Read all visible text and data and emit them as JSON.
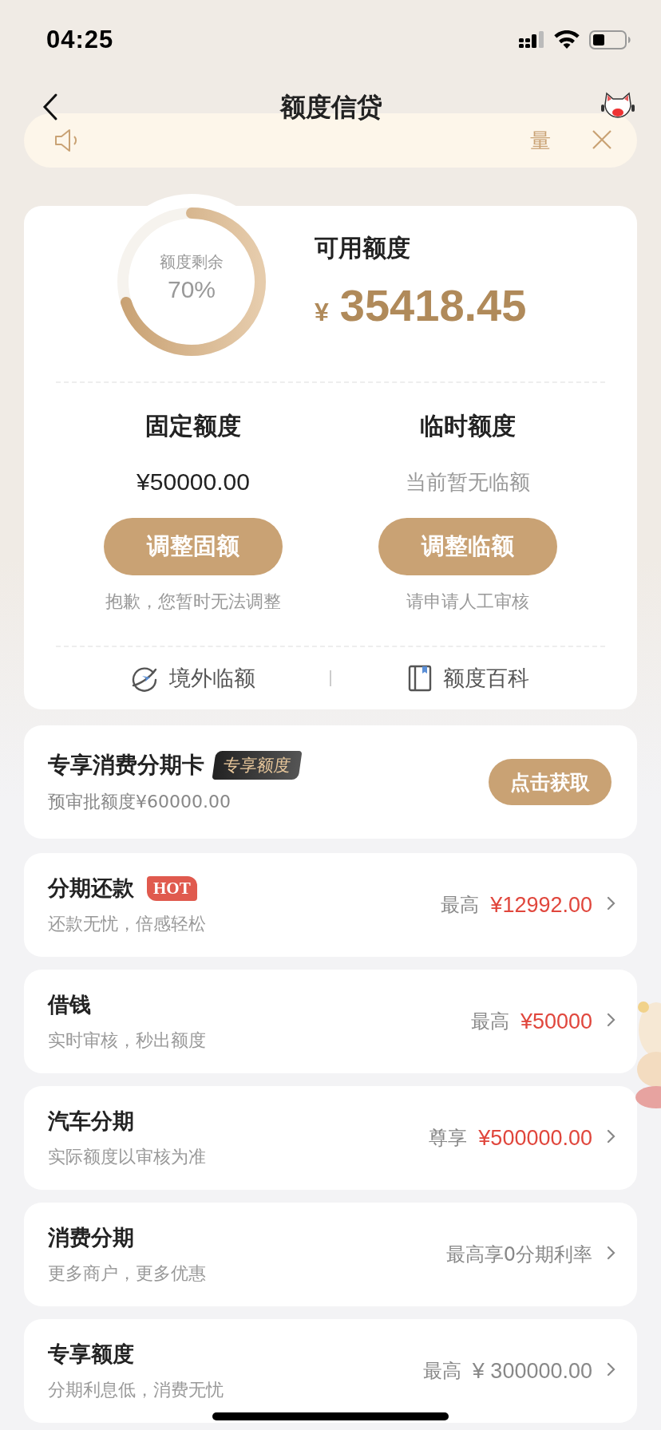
{
  "status_bar": {
    "time": "04:25"
  },
  "nav": {
    "title": "额度信贷"
  },
  "notice": {
    "text": "量"
  },
  "quota": {
    "ring_label": "额度剩余",
    "ring_percent": "70%",
    "available_label": "可用额度",
    "currency": "¥",
    "available_amount": "35418.45",
    "columns": [
      {
        "title": "固定额度",
        "value": "¥50000.00",
        "muted": false,
        "button": "调整固额",
        "hint": "抱歉，您暂时无法调整"
      },
      {
        "title": "临时额度",
        "value": "当前暂无临额",
        "muted": true,
        "button": "调整临额",
        "hint": "请申请人工审核"
      }
    ],
    "links": [
      {
        "kind": "globe",
        "label": "境外临额"
      },
      {
        "kind": "book",
        "label": "额度百科"
      }
    ]
  },
  "exclusive_card": {
    "title": "专享消费分期卡",
    "badge": "专享额度",
    "subtitle": "预审批额度¥60000.00",
    "button": "点击获取"
  },
  "products": [
    {
      "title": "分期还款",
      "badge": "HOT",
      "subtitle": "还款无忧，倍感轻松",
      "offer_label": "最高",
      "offer_value": "¥12992.00",
      "highlight": true
    },
    {
      "title": "借钱",
      "subtitle": "实时审核，秒出额度",
      "offer_label": "最高",
      "offer_value": "¥50000",
      "highlight": true
    },
    {
      "title": "汽车分期",
      "subtitle": "实际额度以审核为准",
      "offer_label": "尊享",
      "offer_value": "¥500000.00",
      "highlight": true
    },
    {
      "title": "消费分期",
      "subtitle": "更多商户，更多优惠",
      "offer_label": "最高享0分期利率"
    },
    {
      "title": "专享额度",
      "subtitle": "分期利息低，消费无忧",
      "offer_label": "最高",
      "offer_value": "¥ 300000.00",
      "highlight": false
    }
  ]
}
